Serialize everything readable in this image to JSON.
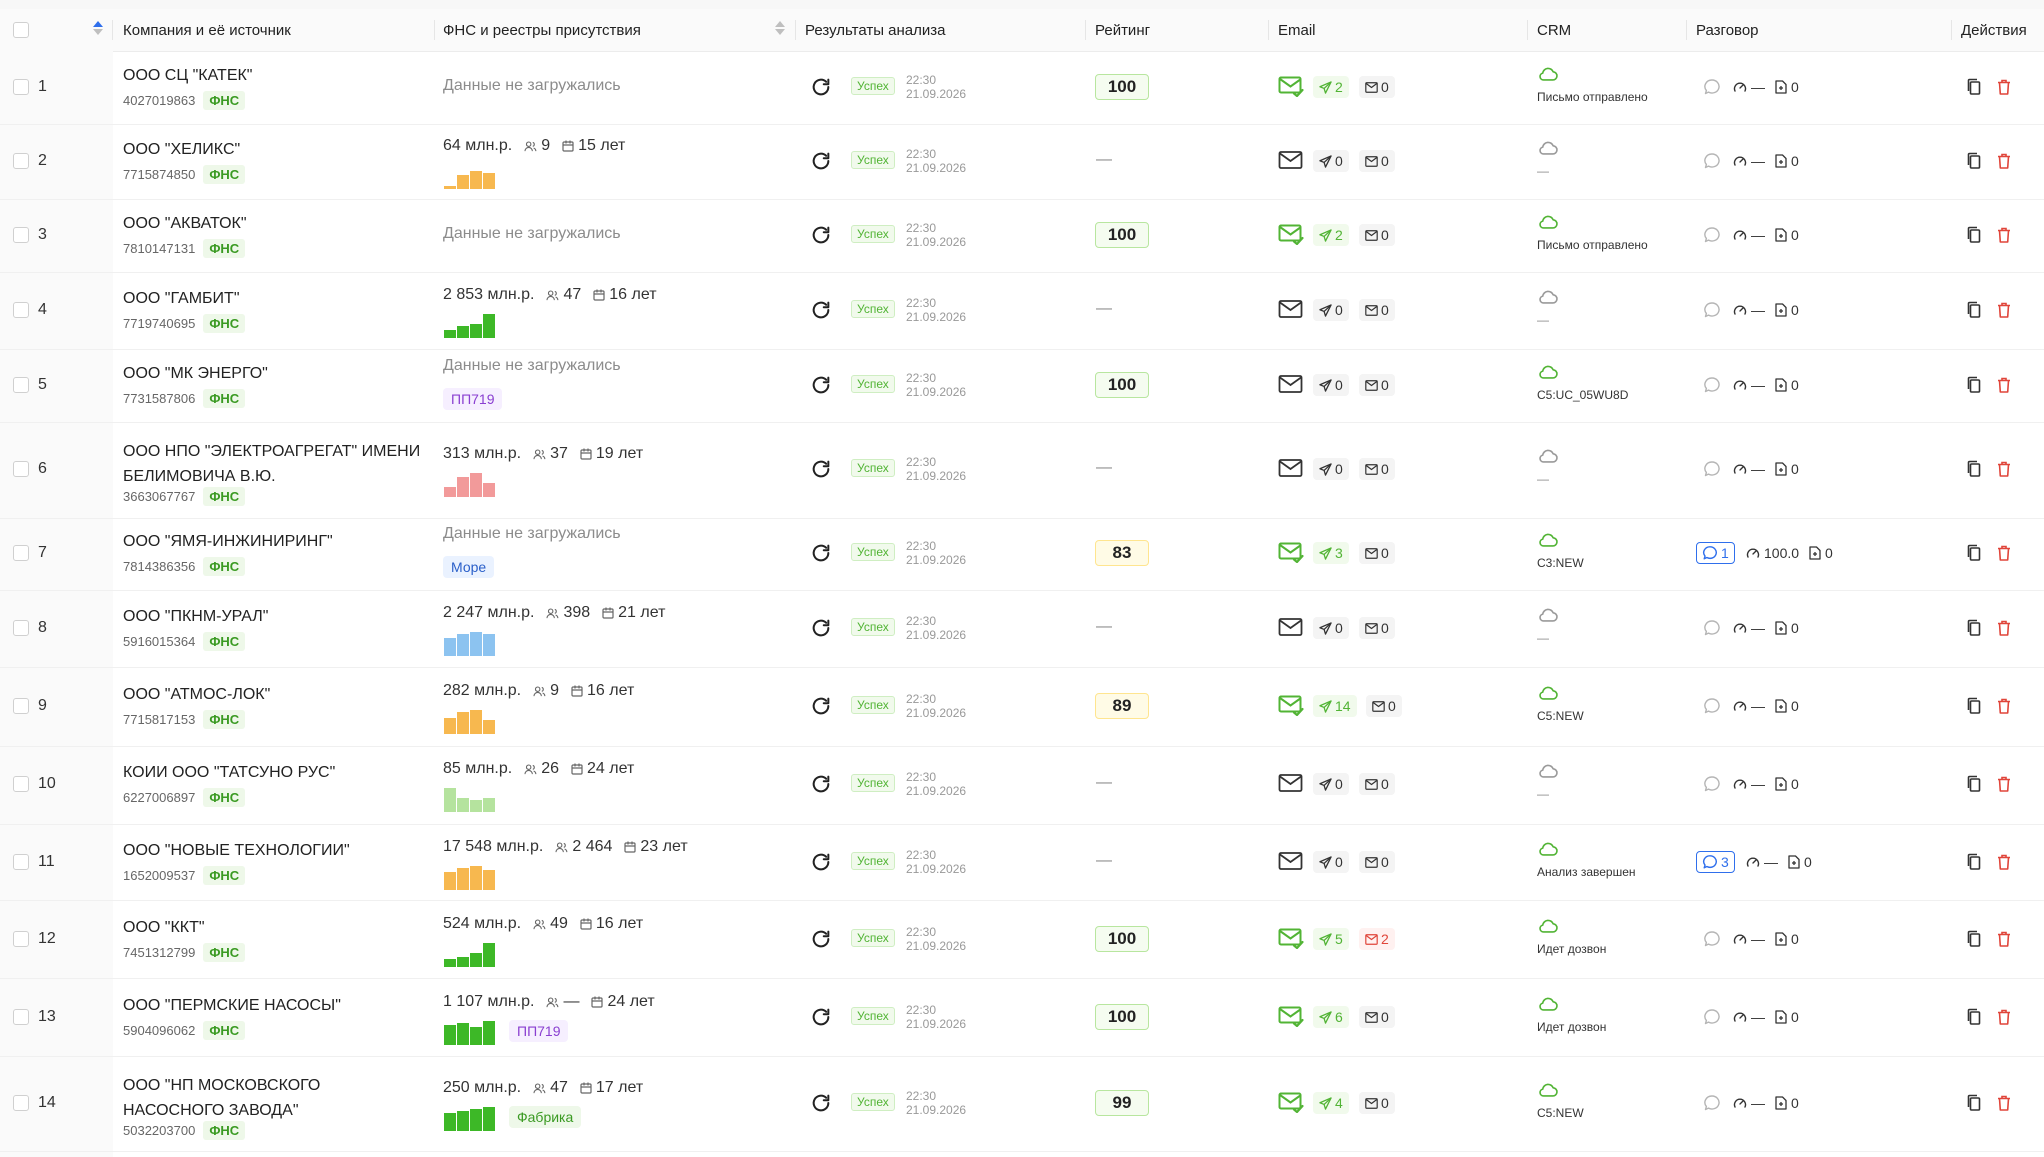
{
  "header": {
    "company": "Компания и её источник",
    "fns": "ФНС и реестры присутствия",
    "analysis": "Результаты анализа",
    "rating": "Рейтинг",
    "email": "Email",
    "crm": "CRM",
    "conversation": "Разговор",
    "actions": "Действия"
  },
  "colors": {
    "accent": "#2f6fec",
    "success": "#52b435",
    "danger": "#e0453a"
  },
  "rows": [
    {
      "n": "1",
      "name": "ООО СЦ \"КАТЕК\"",
      "inn": "4027019863",
      "src": "ФНС",
      "fns": null,
      "tag": null,
      "status": "Успех",
      "time": "22:30",
      "date": "21.09.2026",
      "rating": "100",
      "rc": "green",
      "mailActive": true,
      "sent": "2",
      "sentGreen": true,
      "inbox": "0",
      "inboxRed": false,
      "crmActive": true,
      "crm": "Письмо отправлено",
      "chat": null,
      "conv": "—",
      "docs": "0"
    },
    {
      "n": "2",
      "name": "ООО \"ХЕЛИКС\"",
      "inn": "7715874850",
      "src": "ФНС",
      "fns": {
        "rev": "64 млн.р.",
        "emp": "9",
        "age": "15 лет",
        "color": "#f7b84f",
        "bars": [
          3,
          14,
          18,
          16
        ]
      },
      "tag": null,
      "status": "Успех",
      "time": "22:30",
      "date": "21.09.2026",
      "rating": null,
      "mailActive": false,
      "sent": "0",
      "sentGreen": false,
      "inbox": "0",
      "inboxRed": false,
      "crmActive": false,
      "crm": "—",
      "chat": null,
      "conv": "—",
      "docs": "0"
    },
    {
      "n": "3",
      "name": "ООО \"АКВАТОК\"",
      "inn": "7810147131",
      "src": "ФНС",
      "fns": null,
      "tag": null,
      "status": "Успех",
      "time": "22:30",
      "date": "21.09.2026",
      "rating": "100",
      "rc": "green",
      "mailActive": true,
      "sent": "2",
      "sentGreen": true,
      "inbox": "0",
      "inboxRed": false,
      "crmActive": true,
      "crm": "Письмо отправлено",
      "chat": null,
      "conv": "—",
      "docs": "0"
    },
    {
      "n": "4",
      "name": "ООО \"ГАМБИТ\"",
      "inn": "7719740695",
      "src": "ФНС",
      "fns": {
        "rev": "2 853 млн.р.",
        "emp": "47",
        "age": "16 лет",
        "color": "#3db827",
        "bars": [
          8,
          12,
          14,
          24
        ]
      },
      "tag": null,
      "status": "Успех",
      "time": "22:30",
      "date": "21.09.2026",
      "rating": null,
      "mailActive": false,
      "sent": "0",
      "sentGreen": false,
      "inbox": "0",
      "inboxRed": false,
      "crmActive": false,
      "crm": "—",
      "chat": null,
      "conv": "—",
      "docs": "0"
    },
    {
      "n": "5",
      "name": "ООО \"МК ЭНЕРГО\"",
      "inn": "7731587806",
      "src": "ФНС",
      "fns": null,
      "tag": {
        "text": "ПП719",
        "style": "purple"
      },
      "status": "Успех",
      "time": "22:30",
      "date": "21.09.2026",
      "rating": "100",
      "rc": "green",
      "mailActive": false,
      "sent": "0",
      "sentGreen": false,
      "inbox": "0",
      "inboxRed": false,
      "crmActive": true,
      "crm": "C5:UC_05WU8D",
      "chat": null,
      "conv": "—",
      "docs": "0"
    },
    {
      "n": "6",
      "name": "ООО НПО \"ЭЛЕКТРОАГРЕГАТ\" ИМЕНИ БЕЛИМОВИЧА В.Ю.",
      "inn": "3663067767",
      "src": "ФНС",
      "fns": {
        "rev": "313 млн.р.",
        "emp": "37",
        "age": "19 лет",
        "color": "#f29a9a",
        "bars": [
          10,
          20,
          24,
          14
        ]
      },
      "tag": null,
      "status": "Успех",
      "time": "22:30",
      "date": "21.09.2026",
      "rating": null,
      "mailActive": false,
      "sent": "0",
      "sentGreen": false,
      "inbox": "0",
      "inboxRed": false,
      "crmActive": false,
      "crm": "—",
      "chat": null,
      "conv": "—",
      "docs": "0"
    },
    {
      "n": "7",
      "name": "ООО \"ЯМЯ-ИНЖИНИРИНГ\"",
      "inn": "7814386356",
      "src": "ФНС",
      "fns": null,
      "tag": {
        "text": "Море",
        "style": "blue"
      },
      "status": "Успех",
      "time": "22:30",
      "date": "21.09.2026",
      "rating": "83",
      "rc": "yellow",
      "mailActive": true,
      "sent": "3",
      "sentGreen": true,
      "inbox": "0",
      "inboxRed": false,
      "crmActive": true,
      "crm": "C3:NEW",
      "chat": "1",
      "conv": "100.0",
      "docs": "0"
    },
    {
      "n": "8",
      "name": "ООО \"ПКНМ-УРАЛ\"",
      "inn": "5916015364",
      "src": "ФНС",
      "fns": {
        "rev": "2 247 млн.р.",
        "emp": "398",
        "age": "21 лет",
        "color": "#8cc3f0",
        "bars": [
          18,
          22,
          24,
          22
        ]
      },
      "tag": null,
      "status": "Успех",
      "time": "22:30",
      "date": "21.09.2026",
      "rating": null,
      "mailActive": false,
      "sent": "0",
      "sentGreen": false,
      "inbox": "0",
      "inboxRed": false,
      "crmActive": false,
      "crm": "—",
      "chat": null,
      "conv": "—",
      "docs": "0"
    },
    {
      "n": "9",
      "name": "ООО \"АТМОС-ЛОК\"",
      "inn": "7715817153",
      "src": "ФНС",
      "fns": {
        "rev": "282 млн.р.",
        "emp": "9",
        "age": "16 лет",
        "color": "#f7b84f",
        "bars": [
          16,
          22,
          24,
          14
        ]
      },
      "tag": null,
      "status": "Успех",
      "time": "22:30",
      "date": "21.09.2026",
      "rating": "89",
      "rc": "yellow",
      "mailActive": true,
      "sent": "14",
      "sentGreen": true,
      "inbox": "0",
      "inboxRed": false,
      "crmActive": true,
      "crm": "C5:NEW",
      "chat": null,
      "conv": "—",
      "docs": "0"
    },
    {
      "n": "10",
      "name": "КОИИ ООО \"ТАТСУНО РУС\"",
      "inn": "6227006897",
      "src": "ФНС",
      "fns": {
        "rev": "85 млн.р.",
        "emp": "26",
        "age": "24 лет",
        "color": "#b5e39e",
        "bars": [
          24,
          14,
          12,
          14
        ]
      },
      "tag": null,
      "status": "Успех",
      "time": "22:30",
      "date": "21.09.2026",
      "rating": null,
      "mailActive": false,
      "sent": "0",
      "sentGreen": false,
      "inbox": "0",
      "inboxRed": false,
      "crmActive": false,
      "crm": "—",
      "chat": null,
      "conv": "—",
      "docs": "0"
    },
    {
      "n": "11",
      "name": "ООО \"НОВЫЕ ТЕХНОЛОГИИ\"",
      "inn": "1652009537",
      "src": "ФНС",
      "fns": {
        "rev": "17 548 млн.р.",
        "emp": "2 464",
        "age": "23 лет",
        "color": "#f7b84f",
        "bars": [
          18,
          22,
          24,
          20
        ]
      },
      "tag": null,
      "status": "Успех",
      "time": "22:30",
      "date": "21.09.2026",
      "rating": null,
      "mailActive": false,
      "sent": "0",
      "sentGreen": false,
      "inbox": "0",
      "inboxRed": false,
      "crmActive": true,
      "crm": "Анализ завершен",
      "chat": "3",
      "conv": "—",
      "docs": "0"
    },
    {
      "n": "12",
      "name": "ООО \"ККТ\"",
      "inn": "7451312799",
      "src": "ФНС",
      "fns": {
        "rev": "524 млн.р.",
        "emp": "49",
        "age": "16 лет",
        "color": "#3db827",
        "bars": [
          8,
          10,
          14,
          24
        ]
      },
      "tag": null,
      "status": "Успех",
      "time": "22:30",
      "date": "21.09.2026",
      "rating": "100",
      "rc": "green",
      "mailActive": true,
      "sent": "5",
      "sentGreen": true,
      "inbox": "2",
      "inboxRed": true,
      "crmActive": true,
      "crm": "Идет дозвон",
      "chat": null,
      "conv": "—",
      "docs": "0"
    },
    {
      "n": "13",
      "name": "ООО \"ПЕРМСКИЕ НАСОСЫ\"",
      "inn": "5904096062",
      "src": "ФНС",
      "fns": {
        "rev": "1 107 млн.р.",
        "emp": "—",
        "age": "24 лет",
        "color": "#3db827",
        "bars": [
          20,
          22,
          18,
          24
        ]
      },
      "tag": {
        "text": "ПП719",
        "style": "purple"
      },
      "status": "Успех",
      "time": "22:30",
      "date": "21.09.2026",
      "rating": "100",
      "rc": "green",
      "mailActive": true,
      "sent": "6",
      "sentGreen": true,
      "inbox": "0",
      "inboxRed": false,
      "crmActive": true,
      "crm": "Идет дозвон",
      "chat": null,
      "conv": "—",
      "docs": "0"
    },
    {
      "n": "14",
      "name": "ООО \"НП МОСКОВСКОГО НАСОСНОГО ЗАВОДА\"",
      "inn": "5032203700",
      "src": "ФНС",
      "fns": {
        "rev": "250 млн.р.",
        "emp": "47",
        "age": "17 лет",
        "color": "#3db827",
        "bars": [
          18,
          20,
          22,
          24
        ]
      },
      "tag": {
        "text": "Фабрика",
        "style": "green"
      },
      "status": "Успех",
      "time": "22:30",
      "date": "21.09.2026",
      "rating": "99",
      "rc": "green",
      "mailActive": true,
      "sent": "4",
      "sentGreen": true,
      "inbox": "0",
      "inboxRed": false,
      "crmActive": true,
      "crm": "C5:NEW",
      "chat": null,
      "conv": "—",
      "docs": "0"
    }
  ]
}
